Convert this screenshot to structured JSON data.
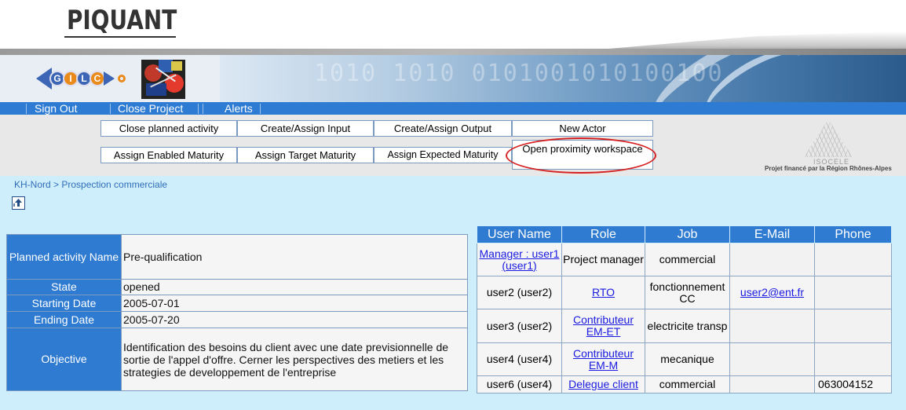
{
  "app": {
    "title": "PIQUANT"
  },
  "menu": [
    {
      "label": "Sign Out"
    },
    {
      "label": "Close Project"
    },
    {
      "label": "Alerts"
    }
  ],
  "actions": {
    "close_planned": "Close planned activity",
    "create_input": "Create/Assign Input",
    "create_output": "Create/Assign Output",
    "new_actor": "New Actor",
    "assign_enabled": "Assign Enabled Maturity",
    "assign_target": "Assign Target Maturity",
    "assign_expected": "Assign Expected Maturity",
    "open_proximity": "Open proximity workspace"
  },
  "partner": {
    "name": "ISOCELE",
    "caption": "Projet financé par la Région Rhônes-Alpes"
  },
  "breadcrumb": "KH-Nord > Prospection commerciale",
  "activity": {
    "labels": {
      "name": "Planned activity Name",
      "state": "State",
      "start": "Starting Date",
      "end": "Ending Date",
      "objective": "Objective"
    },
    "values": {
      "name": "Pre-qualification",
      "state": "opened",
      "start": "2005-07-01",
      "end": "2005-07-20",
      "objective": "Identification des besoins du client avec une date previsionnelle de sortie de l'appel d'offre. Cerner les perspectives des metiers et les strategies de developpement de l'entreprise"
    }
  },
  "users": {
    "headers": [
      "User Name",
      "Role",
      "Job",
      "E-Mail",
      "Phone"
    ],
    "rows": [
      {
        "user": "Manager : user1 (user1)",
        "user_link": true,
        "role": "Project manager",
        "role_link": false,
        "job": "commercial",
        "email": "",
        "phone": ""
      },
      {
        "user": "user2 (user2)",
        "user_link": false,
        "role": "RTO",
        "role_link": true,
        "job": "fonctionnement CC",
        "email": "user2@ent.fr",
        "phone": ""
      },
      {
        "user": "user3 (user2)",
        "user_link": false,
        "role": "Contributeur EM-ET",
        "role_link": true,
        "job": "electricite transp",
        "email": "",
        "phone": ""
      },
      {
        "user": "user4 (user4)",
        "user_link": false,
        "role": "Contributeur EM-M",
        "role_link": true,
        "job": "mecanique",
        "email": "",
        "phone": ""
      },
      {
        "user": "user6 (user4)",
        "user_link": false,
        "role": "Delegue client",
        "role_link": true,
        "job": "commercial",
        "email": "",
        "phone": "063004152"
      }
    ]
  },
  "colors": {
    "accent": "#2e7bd1",
    "background": "#cfeefb",
    "highlight": "#d6201f"
  }
}
